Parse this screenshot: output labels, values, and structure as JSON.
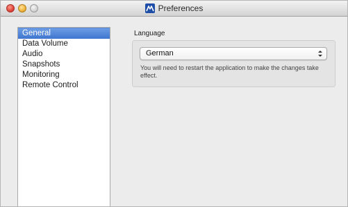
{
  "window": {
    "title": "Preferences",
    "app_icon": "m-logo-icon"
  },
  "sidebar": {
    "selected": "General",
    "items": [
      {
        "label": "General"
      },
      {
        "label": "Data Volume"
      },
      {
        "label": "Audio"
      },
      {
        "label": "Snapshots"
      },
      {
        "label": "Monitoring"
      },
      {
        "label": "Remote Control"
      }
    ]
  },
  "language": {
    "label": "Language",
    "selected_value": "German",
    "note": "You will need to restart the application to make the changes take effect."
  },
  "colors": {
    "selection": "#3e75cf",
    "window_bg": "#ececec"
  }
}
